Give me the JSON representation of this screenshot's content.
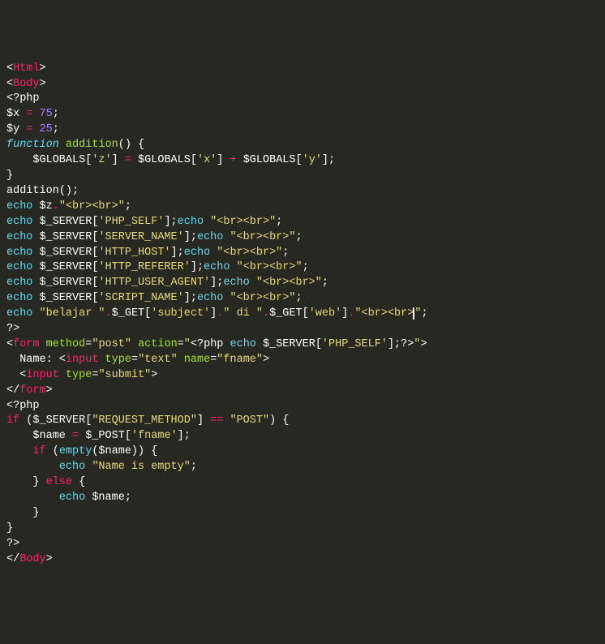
{
  "colors": {
    "bg": "#272822",
    "default": "#f8f8f2",
    "pink": "#f92672",
    "green": "#a6e22e",
    "cyan": "#66d9ef",
    "orange": "#fd971f",
    "yellow": "#e6db74",
    "purple": "#ae81ff",
    "gray": "#75715e",
    "white": "#ffffff"
  },
  "code_lines": [
    [
      {
        "t": "<",
        "c": "white"
      },
      {
        "t": "Html",
        "c": "pink"
      },
      {
        "t": ">",
        "c": "white"
      }
    ],
    [
      {
        "t": "<",
        "c": "white"
      },
      {
        "t": "Body",
        "c": "pink"
      },
      {
        "t": ">",
        "c": "white"
      }
    ],
    [
      {
        "t": "<?php",
        "c": "white"
      }
    ],
    [
      {
        "t": "$x",
        "c": "white"
      },
      {
        "t": " ",
        "c": "white"
      },
      {
        "t": "=",
        "c": "pink"
      },
      {
        "t": " ",
        "c": "white"
      },
      {
        "t": "75",
        "c": "purple"
      },
      {
        "t": ";",
        "c": "white"
      }
    ],
    [
      {
        "t": "$y",
        "c": "white"
      },
      {
        "t": " ",
        "c": "white"
      },
      {
        "t": "=",
        "c": "pink"
      },
      {
        "t": " ",
        "c": "white"
      },
      {
        "t": "25",
        "c": "purple"
      },
      {
        "t": ";",
        "c": "white"
      }
    ],
    [
      {
        "t": "function",
        "c": "cyan",
        "i": true
      },
      {
        "t": " ",
        "c": "white"
      },
      {
        "t": "addition",
        "c": "green"
      },
      {
        "t": "() {",
        "c": "white"
      }
    ],
    [
      {
        "t": "    $GLOBALS[",
        "c": "white"
      },
      {
        "t": "'z'",
        "c": "yellow"
      },
      {
        "t": "] ",
        "c": "white"
      },
      {
        "t": "=",
        "c": "pink"
      },
      {
        "t": " $GLOBALS[",
        "c": "white"
      },
      {
        "t": "'x'",
        "c": "yellow"
      },
      {
        "t": "] ",
        "c": "white"
      },
      {
        "t": "+",
        "c": "pink"
      },
      {
        "t": " $GLOBALS[",
        "c": "white"
      },
      {
        "t": "'y'",
        "c": "yellow"
      },
      {
        "t": "];",
        "c": "white"
      }
    ],
    [
      {
        "t": "}",
        "c": "white"
      }
    ],
    [
      {
        "t": "addition",
        "c": "white"
      },
      {
        "t": "();",
        "c": "white"
      }
    ],
    [
      {
        "t": "echo",
        "c": "cyan"
      },
      {
        "t": " $z",
        "c": "white"
      },
      {
        "t": ".",
        "c": "pink"
      },
      {
        "t": "\"<br><br>\"",
        "c": "yellow"
      },
      {
        "t": ";",
        "c": "white"
      }
    ],
    [
      {
        "t": "echo",
        "c": "cyan"
      },
      {
        "t": " $_SERVER[",
        "c": "white"
      },
      {
        "t": "'PHP_SELF'",
        "c": "yellow"
      },
      {
        "t": "];",
        "c": "white"
      },
      {
        "t": "echo",
        "c": "cyan"
      },
      {
        "t": " ",
        "c": "white"
      },
      {
        "t": "\"<br><br>\"",
        "c": "yellow"
      },
      {
        "t": ";",
        "c": "white"
      }
    ],
    [
      {
        "t": "echo",
        "c": "cyan"
      },
      {
        "t": " $_SERVER[",
        "c": "white"
      },
      {
        "t": "'SERVER_NAME'",
        "c": "yellow"
      },
      {
        "t": "];",
        "c": "white"
      },
      {
        "t": "echo",
        "c": "cyan"
      },
      {
        "t": " ",
        "c": "white"
      },
      {
        "t": "\"<br><br>\"",
        "c": "yellow"
      },
      {
        "t": ";",
        "c": "white"
      }
    ],
    [
      {
        "t": "echo",
        "c": "cyan"
      },
      {
        "t": " $_SERVER[",
        "c": "white"
      },
      {
        "t": "'HTTP_HOST'",
        "c": "yellow"
      },
      {
        "t": "];",
        "c": "white"
      },
      {
        "t": "echo",
        "c": "cyan"
      },
      {
        "t": " ",
        "c": "white"
      },
      {
        "t": "\"<br><br>\"",
        "c": "yellow"
      },
      {
        "t": ";",
        "c": "white"
      }
    ],
    [
      {
        "t": "echo",
        "c": "cyan"
      },
      {
        "t": " $_SERVER[",
        "c": "white"
      },
      {
        "t": "'HTTP_REFERER'",
        "c": "yellow"
      },
      {
        "t": "];",
        "c": "white"
      },
      {
        "t": "echo",
        "c": "cyan"
      },
      {
        "t": " ",
        "c": "white"
      },
      {
        "t": "\"<br><br>\"",
        "c": "yellow"
      },
      {
        "t": ";",
        "c": "white"
      }
    ],
    [
      {
        "t": "echo",
        "c": "cyan"
      },
      {
        "t": " $_SERVER[",
        "c": "white"
      },
      {
        "t": "'HTTP_USER_AGENT'",
        "c": "yellow"
      },
      {
        "t": "];",
        "c": "white"
      },
      {
        "t": "echo",
        "c": "cyan"
      },
      {
        "t": " ",
        "c": "white"
      },
      {
        "t": "\"<br><br>\"",
        "c": "yellow"
      },
      {
        "t": ";",
        "c": "white"
      }
    ],
    [
      {
        "t": "echo",
        "c": "cyan"
      },
      {
        "t": " $_SERVER[",
        "c": "white"
      },
      {
        "t": "'SCRIPT_NAME'",
        "c": "yellow"
      },
      {
        "t": "];",
        "c": "white"
      },
      {
        "t": "echo",
        "c": "cyan"
      },
      {
        "t": " ",
        "c": "white"
      },
      {
        "t": "\"<br><br>\"",
        "c": "yellow"
      },
      {
        "t": ";",
        "c": "white"
      }
    ],
    [
      {
        "t": "echo",
        "c": "cyan"
      },
      {
        "t": " ",
        "c": "white"
      },
      {
        "t": "\"belajar \"",
        "c": "yellow"
      },
      {
        "t": ".",
        "c": "pink"
      },
      {
        "t": "$_GET[",
        "c": "white"
      },
      {
        "t": "'subject'",
        "c": "yellow"
      },
      {
        "t": "]",
        "c": "white"
      },
      {
        "t": ".",
        "c": "pink"
      },
      {
        "t": "\" di \"",
        "c": "yellow"
      },
      {
        "t": ".",
        "c": "pink"
      },
      {
        "t": "$_GET[",
        "c": "white"
      },
      {
        "t": "'web'",
        "c": "yellow"
      },
      {
        "t": "]",
        "c": "white"
      },
      {
        "t": ".",
        "c": "pink"
      },
      {
        "t": "\"<br><br>",
        "c": "yellow"
      },
      {
        "t": "",
        "cursor": true
      },
      {
        "t": "\"",
        "c": "yellow"
      },
      {
        "t": ";",
        "c": "white"
      }
    ],
    [
      {
        "t": "?>",
        "c": "white"
      }
    ],
    [
      {
        "t": "<",
        "c": "white"
      },
      {
        "t": "form",
        "c": "pink"
      },
      {
        "t": " ",
        "c": "white"
      },
      {
        "t": "method",
        "c": "green"
      },
      {
        "t": "=",
        "c": "white"
      },
      {
        "t": "\"post\"",
        "c": "yellow"
      },
      {
        "t": " ",
        "c": "white"
      },
      {
        "t": "action",
        "c": "green"
      },
      {
        "t": "=",
        "c": "white"
      },
      {
        "t": "\"",
        "c": "yellow"
      },
      {
        "t": "<?php ",
        "c": "white"
      },
      {
        "t": "echo",
        "c": "cyan"
      },
      {
        "t": " $_SERVER[",
        "c": "white"
      },
      {
        "t": "'PHP_SELF'",
        "c": "yellow"
      },
      {
        "t": "];",
        "c": "white"
      },
      {
        "t": "?>",
        "c": "white"
      },
      {
        "t": "\"",
        "c": "yellow"
      },
      {
        "t": ">",
        "c": "white"
      }
    ],
    [
      {
        "t": "  Name: <",
        "c": "white"
      },
      {
        "t": "input",
        "c": "pink"
      },
      {
        "t": " ",
        "c": "white"
      },
      {
        "t": "type",
        "c": "green"
      },
      {
        "t": "=",
        "c": "white"
      },
      {
        "t": "\"text\"",
        "c": "yellow"
      },
      {
        "t": " ",
        "c": "white"
      },
      {
        "t": "name",
        "c": "green"
      },
      {
        "t": "=",
        "c": "white"
      },
      {
        "t": "\"fname\"",
        "c": "yellow"
      },
      {
        "t": ">",
        "c": "white"
      }
    ],
    [
      {
        "t": "  <",
        "c": "white"
      },
      {
        "t": "input",
        "c": "pink"
      },
      {
        "t": " ",
        "c": "white"
      },
      {
        "t": "type",
        "c": "green"
      },
      {
        "t": "=",
        "c": "white"
      },
      {
        "t": "\"submit\"",
        "c": "yellow"
      },
      {
        "t": ">",
        "c": "white"
      }
    ],
    [
      {
        "t": "</",
        "c": "white"
      },
      {
        "t": "form",
        "c": "pink"
      },
      {
        "t": ">",
        "c": "white"
      }
    ],
    [
      {
        "t": "<?php",
        "c": "white"
      }
    ],
    [
      {
        "t": "if",
        "c": "pink"
      },
      {
        "t": " ($_SERVER[",
        "c": "white"
      },
      {
        "t": "\"REQUEST_METHOD\"",
        "c": "yellow"
      },
      {
        "t": "] ",
        "c": "white"
      },
      {
        "t": "==",
        "c": "pink"
      },
      {
        "t": " ",
        "c": "white"
      },
      {
        "t": "\"POST\"",
        "c": "yellow"
      },
      {
        "t": ") {",
        "c": "white"
      }
    ],
    [
      {
        "t": "    $name ",
        "c": "white"
      },
      {
        "t": "=",
        "c": "pink"
      },
      {
        "t": " $_POST[",
        "c": "white"
      },
      {
        "t": "'fname'",
        "c": "yellow"
      },
      {
        "t": "];",
        "c": "white"
      }
    ],
    [
      {
        "t": "    ",
        "c": "white"
      },
      {
        "t": "if",
        "c": "pink"
      },
      {
        "t": " (",
        "c": "white"
      },
      {
        "t": "empty",
        "c": "cyan"
      },
      {
        "t": "($name)) {",
        "c": "white"
      }
    ],
    [
      {
        "t": "        ",
        "c": "white"
      },
      {
        "t": "echo",
        "c": "cyan"
      },
      {
        "t": " ",
        "c": "white"
      },
      {
        "t": "\"Name is empty\"",
        "c": "yellow"
      },
      {
        "t": ";",
        "c": "white"
      }
    ],
    [
      {
        "t": "    } ",
        "c": "white"
      },
      {
        "t": "else",
        "c": "pink"
      },
      {
        "t": " {",
        "c": "white"
      }
    ],
    [
      {
        "t": "        ",
        "c": "white"
      },
      {
        "t": "echo",
        "c": "cyan"
      },
      {
        "t": " $name;",
        "c": "white"
      }
    ],
    [
      {
        "t": "    }",
        "c": "white"
      }
    ],
    [
      {
        "t": "}",
        "c": "white"
      }
    ],
    [
      {
        "t": "?>",
        "c": "white"
      }
    ],
    [
      {
        "t": "</",
        "c": "white"
      },
      {
        "t": "Body",
        "c": "pink"
      },
      {
        "t": ">",
        "c": "white"
      }
    ]
  ]
}
